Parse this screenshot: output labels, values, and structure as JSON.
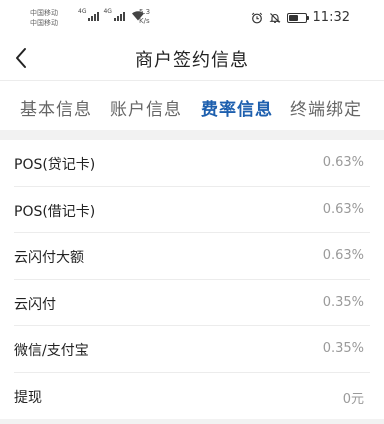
{
  "status_bar": {
    "carrier_1": "中国移动",
    "carrier_2": "中国移动",
    "network_1": "4G",
    "network_2": "4G",
    "speed_value": "5.3",
    "speed_unit": "K/s",
    "time": "11:32",
    "battery_level": 0.6
  },
  "nav": {
    "title": "商户签约信息"
  },
  "tabs": [
    {
      "label": "基本信息",
      "active": false
    },
    {
      "label": "账户信息",
      "active": false
    },
    {
      "label": "费率信息",
      "active": true
    },
    {
      "label": "终端绑定",
      "active": false
    }
  ],
  "rates": [
    {
      "label": "POS(贷记卡)",
      "value": "0.63%"
    },
    {
      "label": "POS(借记卡)",
      "value": "0.63%"
    },
    {
      "label": "云闪付大额",
      "value": "0.63%"
    },
    {
      "label": "云闪付",
      "value": "0.35%"
    },
    {
      "label": "微信/支付宝",
      "value": "0.35%"
    },
    {
      "label": "提现",
      "value": "0元"
    }
  ],
  "colors": {
    "accent": "#1d5fae",
    "background": "#f2f2f2",
    "value_text": "#9a9a9a"
  }
}
